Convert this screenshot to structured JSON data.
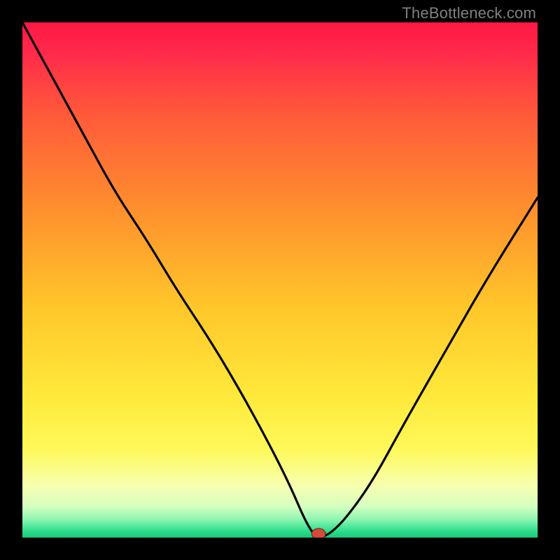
{
  "watermark": "TheBottleneck.com",
  "chart_data": {
    "type": "line",
    "title": "",
    "xlabel": "",
    "ylabel": "",
    "xlim": [
      0,
      100
    ],
    "ylim": [
      0,
      100
    ],
    "series": [
      {
        "name": "bottleneck-curve",
        "x": [
          0,
          6,
          12,
          18,
          24,
          30,
          36,
          42,
          48,
          52,
          55,
          57,
          58,
          60,
          63,
          68,
          74,
          82,
          90,
          100
        ],
        "values": [
          100,
          89,
          78,
          67,
          58,
          48,
          39,
          29,
          18,
          10,
          3,
          0,
          0,
          1,
          4,
          11,
          22,
          36,
          50,
          66
        ]
      }
    ],
    "marker": {
      "x": 57.5,
      "y": 0.2
    },
    "gradient_stops": [
      {
        "offset": 0.0,
        "color": "#ff1744"
      },
      {
        "offset": 0.06,
        "color": "#ff2a4a"
      },
      {
        "offset": 0.18,
        "color": "#ff5a3a"
      },
      {
        "offset": 0.35,
        "color": "#ff8c2e"
      },
      {
        "offset": 0.55,
        "color": "#ffc62a"
      },
      {
        "offset": 0.72,
        "color": "#ffe83a"
      },
      {
        "offset": 0.83,
        "color": "#fff95a"
      },
      {
        "offset": 0.9,
        "color": "#f6ffb0"
      },
      {
        "offset": 0.94,
        "color": "#d5ffc0"
      },
      {
        "offset": 0.965,
        "color": "#8cf5b0"
      },
      {
        "offset": 0.985,
        "color": "#35e090"
      },
      {
        "offset": 1.0,
        "color": "#18c878"
      }
    ]
  }
}
